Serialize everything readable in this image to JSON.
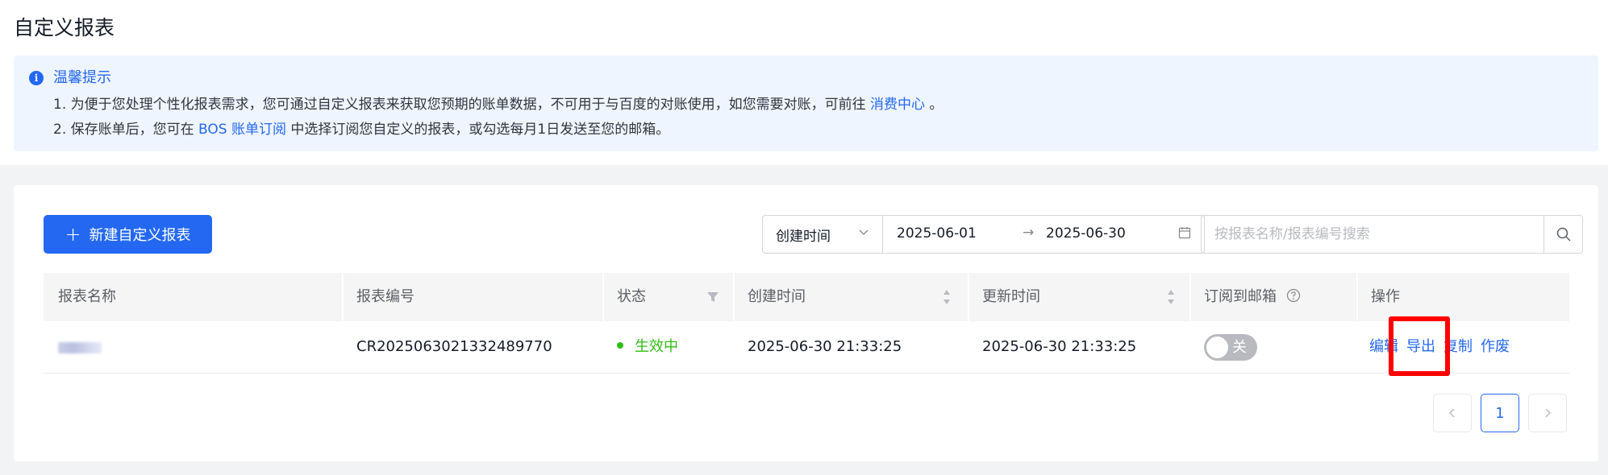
{
  "page": {
    "title": "自定义报表"
  },
  "tips": {
    "title": "温馨提示",
    "line1": {
      "prefix": "1. 为便于您处理个性化报表需求，您可通过自定义报表来获取您预期的账单数据，不可用于与百度的对账使用，如您需要对账，可前往 ",
      "link": "消费中心",
      "suffix": " 。"
    },
    "line2": {
      "prefix": "2. 保存账单后，您可在 ",
      "link": "BOS 账单订阅",
      "suffix": " 中选择订阅您自定义的报表，或勾选每月1日发送至您的邮箱。"
    }
  },
  "toolbar": {
    "new_button_label": "新建自定义报表",
    "date_type": "创建时间",
    "date_start": "2025-06-01",
    "date_arrow": "→",
    "date_end": "2025-06-30",
    "search_placeholder": "按报表名称/报表编号搜索"
  },
  "table": {
    "columns": [
      "报表名称",
      "报表编号",
      "状态",
      "创建时间",
      "更新时间",
      "订阅到邮箱",
      "操作"
    ],
    "rows": [
      {
        "id": "CR2025063021332489770",
        "status": "生效中",
        "created": "2025-06-30 21:33:25",
        "updated": "2025-06-30 21:33:25",
        "subscribe_toggle": "关",
        "subscribed": false,
        "actions": [
          "编辑",
          "导出",
          "复制",
          "作废"
        ]
      }
    ]
  },
  "pagination": {
    "prev": "‹",
    "current": "1",
    "next": "›"
  },
  "colors": {
    "primary": "#2468f2",
    "success": "#30bf13",
    "highlight": "#ff0000",
    "tip_background": "#eef5fe"
  }
}
